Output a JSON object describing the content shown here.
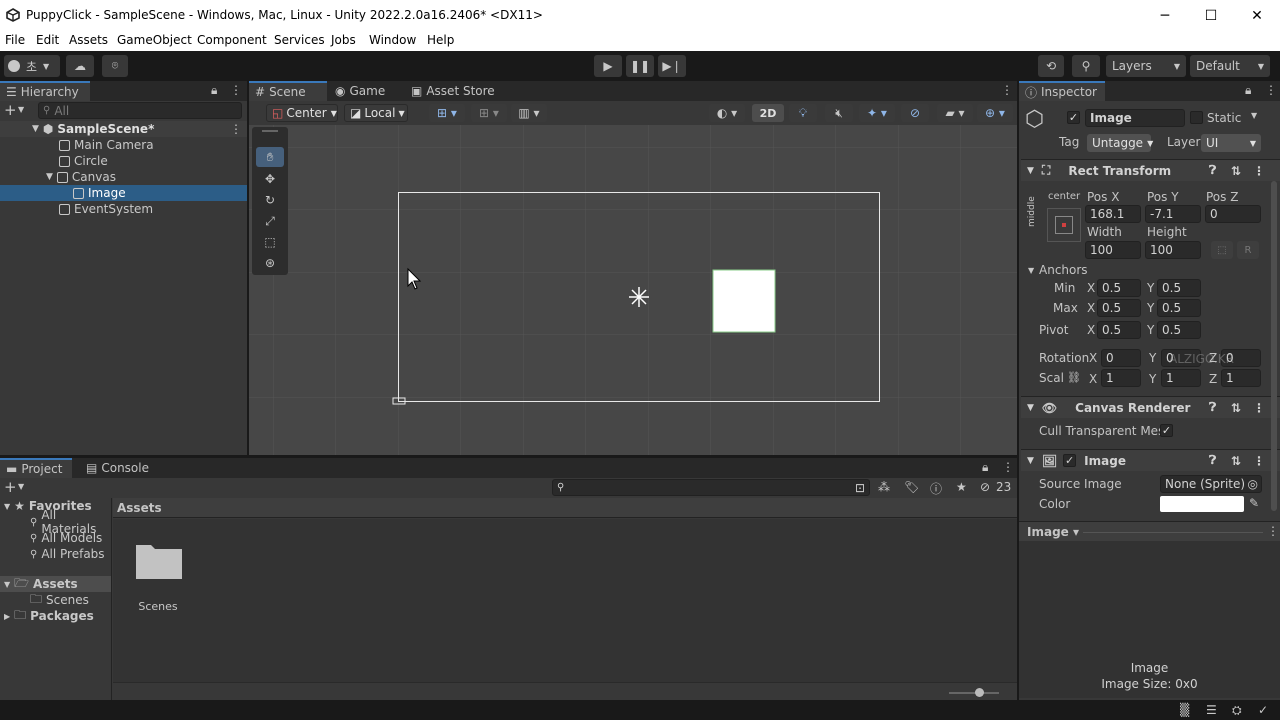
{
  "window": {
    "title": "PuppyClick - SampleScene - Windows, Mac, Linux - Unity 2022.2.0a16.2406* <DX11>",
    "minimize": "─",
    "maximize": "☐",
    "close": "✕"
  },
  "menu": [
    "File",
    "Edit",
    "Assets",
    "GameObject",
    "Component",
    "Services",
    "Jobs",
    "Window",
    "Help"
  ],
  "toolbar": {
    "account_label": "초",
    "layers": "Layers",
    "layout": "Default"
  },
  "hierarchy": {
    "tab": "Hierarchy",
    "search_placeholder": "All",
    "items": [
      {
        "label": "SampleScene*",
        "indent": 0
      },
      {
        "label": "Main Camera",
        "indent": 1
      },
      {
        "label": "Circle",
        "indent": 1
      },
      {
        "label": "Canvas",
        "indent": 1
      },
      {
        "label": "Image",
        "indent": 2
      },
      {
        "label": "EventSystem",
        "indent": 1
      }
    ]
  },
  "scene": {
    "tabs": [
      "Scene",
      "Game",
      "Asset Store"
    ],
    "pivot": "Center",
    "space": "Local",
    "mode_2d": "2D"
  },
  "inspector": {
    "tab": "Inspector",
    "object_name": "Image",
    "static_label": "Static",
    "tag_label": "Tag",
    "tag_value": "Untagge",
    "layer_label": "Layer",
    "layer_value": "UI",
    "rect_transform": {
      "title": "Rect Transform",
      "anchor_h": "center",
      "anchor_v": "middle",
      "pos_x_label": "Pos X",
      "pos_y_label": "Pos Y",
      "pos_z_label": "Pos Z",
      "pos_x": "168.1",
      "pos_y": "-7.1",
      "pos_z": "0",
      "width_label": "Width",
      "height_label": "Height",
      "width": "100",
      "height": "100",
      "r_button": "R",
      "anchors_label": "Anchors",
      "min_label": "Min",
      "max_label": "Max",
      "pivot_label": "Pivot",
      "x": "X",
      "y": "Y",
      "z": "Z",
      "min_x": "0.5",
      "min_y": "0.5",
      "max_x": "0.5",
      "max_y": "0.5",
      "pivot_x": "0.5",
      "pivot_y": "0.5",
      "rotation_label": "Rotation",
      "rot_x": "0",
      "rot_y": "0",
      "rot_z": "0",
      "scale_label": "Scal",
      "scale_x": "1",
      "scale_y": "1",
      "scale_z": "1"
    },
    "canvas_renderer": {
      "title": "Canvas Renderer",
      "cull_label": "Cull Transparent Mes"
    },
    "image": {
      "title": "Image",
      "source_label": "Source Image",
      "source_value": "None (Sprite)",
      "color_label": "Color"
    },
    "preview": {
      "header": "Image ▾",
      "name": "Image",
      "size": "Image Size: 0x0"
    },
    "watermark": "ALZIGO.KR"
  },
  "project": {
    "tabs": [
      "Project",
      "Console"
    ],
    "hidden_count": "23",
    "favorites_label": "Favorites",
    "favorites": [
      "All Materials",
      "All Models",
      "All Prefabs"
    ],
    "assets_label": "Assets",
    "scenes_label": "Scenes",
    "packages_label": "Packages",
    "breadcrumb": "Assets",
    "folder": "Scenes"
  },
  "colors": {
    "accent": "#3a79bb",
    "selection": "#2c5d87",
    "panel": "#383838",
    "scene_bg": "#474747"
  }
}
